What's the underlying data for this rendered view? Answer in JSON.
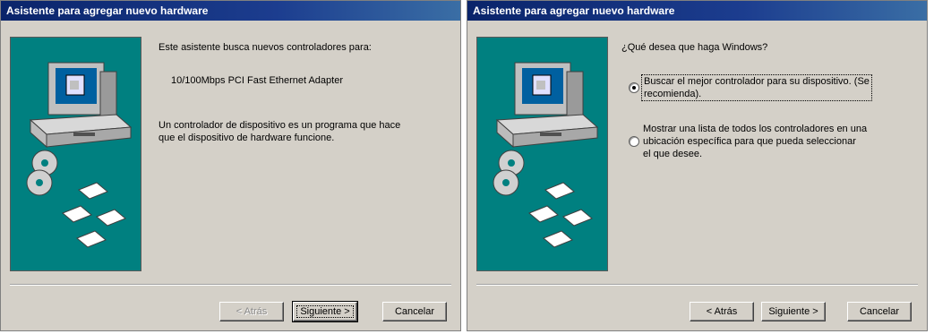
{
  "dialog1": {
    "title": "Asistente para agregar nuevo hardware",
    "intro": "Este asistente busca nuevos controladores para:",
    "device": "10/100Mbps PCI Fast Ethernet Adapter",
    "description_line1": "Un controlador de dispositivo es un programa que hace",
    "description_line2": "que el dispositivo de hardware funcione.",
    "buttons": {
      "back": "< Atrás",
      "next": "Siguiente >",
      "cancel": "Cancelar"
    }
  },
  "dialog2": {
    "title": "Asistente para agregar nuevo hardware",
    "question": "¿Qué desea que haga Windows?",
    "option1_line1": "Buscar el mejor controlador para su dispositivo. (Se",
    "option1_line2": "recomienda).",
    "option1_selected": true,
    "option2_line1": "Mostrar una lista de todos los controladores en una",
    "option2_line2": "ubicación específica para que pueda seleccionar",
    "option2_line3": "el que desee.",
    "option2_selected": false,
    "buttons": {
      "back": "< Atrás",
      "next": "Siguiente >",
      "cancel": "Cancelar"
    }
  },
  "colors": {
    "titlebar": "#0a246a",
    "panel": "#d4d0c8",
    "art_background": "#008080"
  },
  "icons": [
    "computer-icon",
    "cd-disc-icon",
    "floppy-disk-icon"
  ]
}
